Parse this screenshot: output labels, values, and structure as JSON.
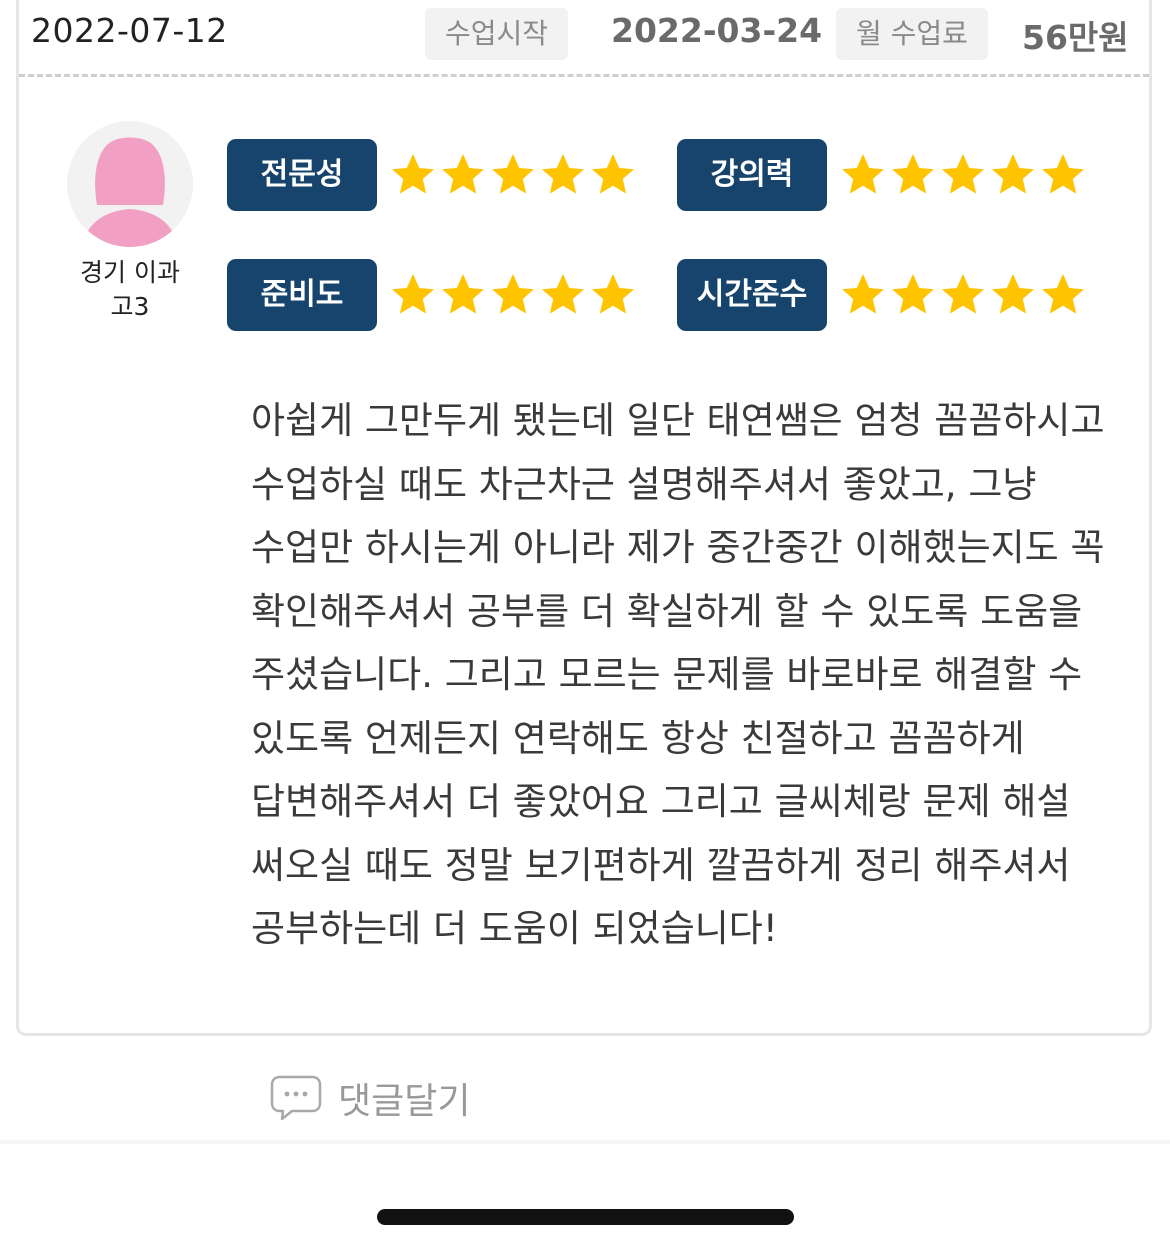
{
  "header": {
    "review_date": "2022-07-12",
    "start_label": "수업시작",
    "start_date": "2022-03-24",
    "fee_label": "월 수업료",
    "fee_amount": "56만원"
  },
  "student": {
    "avatar_icon": "female-user-icon",
    "region": "경기 이과",
    "grade": "고3"
  },
  "ratings": [
    {
      "label": "전문성",
      "stars": 5
    },
    {
      "label": "강의력",
      "stars": 5
    },
    {
      "label": "준비도",
      "stars": 5
    },
    {
      "label": "시간준수",
      "stars": 5
    }
  ],
  "review_text": "아쉽게 그만두게 됐는데 일단 태연쌤은 엄청 꼼꼼하시고 수업하실 때도 차근차근 설명해주셔서 좋았고, 그냥 수업만 하시는게 아니라 제가 중간중간 이해했는지도 꼭 확인해주셔서 공부를 더 확실하게 할 수 있도록 도움을 주셨습니다. 그리고 모르는 문제를 바로바로 해결할 수 있도록 언제든지 연락해도 항상 친절하고 꼼꼼하게 답변해주셔서 더 좋았어요 그리고 글씨체랑 문제 해설 써오실 때도 정말 보기편하게 깔끔하게 정리 해주셔서 공부하는데 더 도움이 되었습니다!",
  "comment": {
    "icon": "speech-bubble-icon",
    "label": "댓글달기"
  },
  "colors": {
    "label_bg": "#17446d",
    "star": "#ffc400",
    "avatar_pink": "#f29fc4"
  }
}
